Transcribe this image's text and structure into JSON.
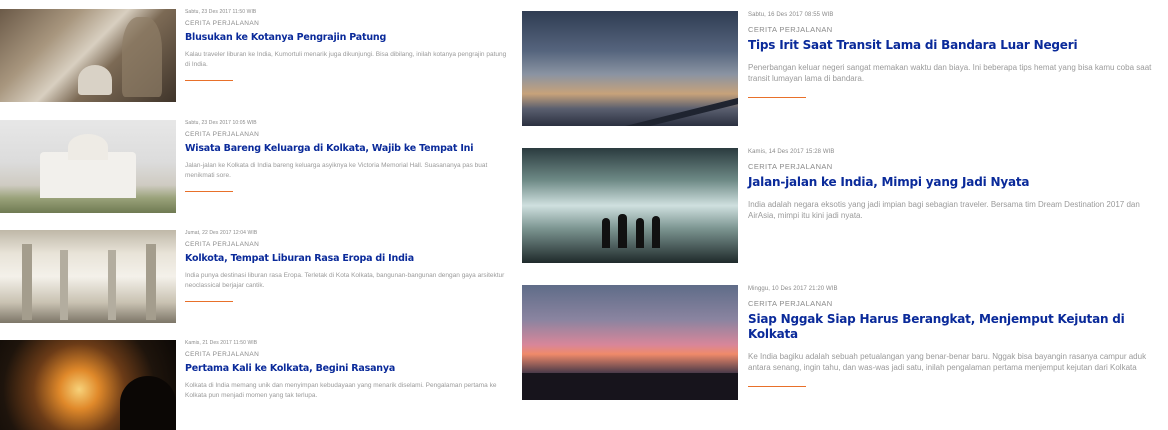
{
  "articles_left": [
    {
      "date": "Sabtu, 23 Des 2017 11:50 WIB",
      "category": "CERITA PERJALANAN",
      "title": "Blusukan ke Kotanya Pengrajin Patung",
      "excerpt": "Kalau traveler liburan ke India, Kumortuli menarik juga dikunjungi. Bisa dibilang, inilah kotanya pengrajin patung di India."
    },
    {
      "date": "Sabtu, 23 Des 2017 10:05 WIB",
      "category": "CERITA PERJALANAN",
      "title": "Wisata Bareng Keluarga di Kolkata, Wajib ke Tempat Ini",
      "excerpt": "Jalan-jalan ke Kolkata di India bareng keluarga asyiknya ke Victoria Memorial Hall. Suasananya pas buat menikmati sore."
    },
    {
      "date": "Jumat, 22 Des 2017 12:04 WIB",
      "category": "CERITA PERJALANAN",
      "title": "Kolkota, Tempat Liburan Rasa Eropa di India",
      "excerpt": "India punya destinasi liburan rasa Eropa. Terletak di Kota Kolkata, bangunan-bangunan dengan gaya arsitektur neoclassical berjajar cantik."
    },
    {
      "date": "Kamis, 21 Des 2017 11:50 WIB",
      "category": "CERITA PERJALANAN",
      "title": "Pertama Kali ke Kolkata, Begini Rasanya",
      "excerpt": "Kolkata di India memang unik dan menyimpan kebudayaan yang menarik diselami. Pengalaman pertama ke Kolkata pun menjadi momen yang tak terlupa."
    }
  ],
  "articles_right": [
    {
      "date": "Sabtu, 16 Des 2017 08:55 WIB",
      "category": "CERITA PERJALANAN",
      "title": "Tips Irit Saat Transit Lama di Bandara Luar Negeri",
      "excerpt": "Penerbangan keluar negeri sangat memakan waktu dan biaya. Ini beberapa tips hemat yang bisa kamu coba saat transit lumayan lama di bandara."
    },
    {
      "date": "Kamis, 14 Des 2017 15:28 WIB",
      "category": "CERITA PERJALANAN",
      "title": "Jalan-jalan ke India, Mimpi yang Jadi Nyata",
      "excerpt": "India adalah negara eksotis yang jadi impian bagi sebagian traveler. Bersama tim Dream Destination 2017 dan AirAsia, mimpi itu kini jadi nyata."
    },
    {
      "date": "Minggu, 10 Des 2017 21:20 WIB",
      "category": "CERITA PERJALANAN",
      "title": "Siap Nggak Siap Harus Berangkat, Menjemput Kejutan di Kolkata",
      "excerpt": "Ke India bagiku adalah sebuah petualangan yang benar-benar baru. Nggak bisa bayangin rasanya campur aduk antara senang, ingin tahu, dan was-was jadi satu, inilah pengalaman pertama menjemput kejutan dari Kolkata"
    }
  ],
  "colors": {
    "title": "#0a2a9a",
    "accent_rule": "#e8702a",
    "meta": "#8a8a8a",
    "excerpt": "#9a9a9a"
  }
}
